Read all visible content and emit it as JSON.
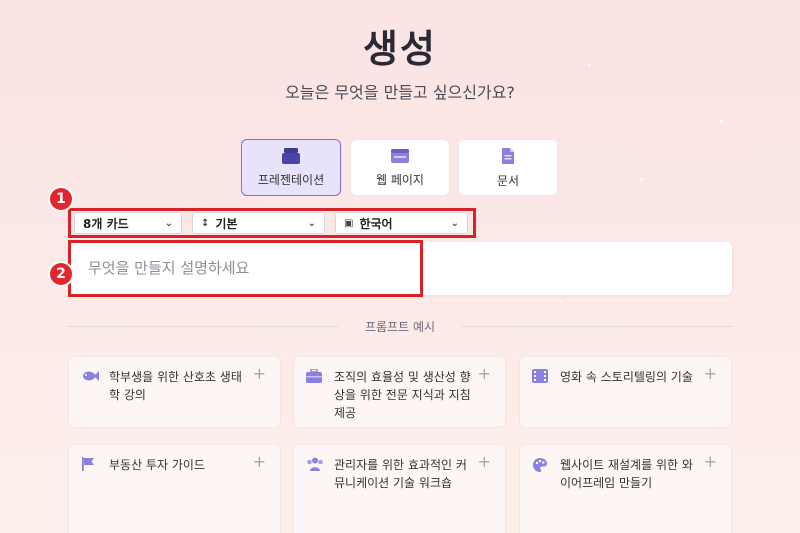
{
  "header": {
    "title": "생성",
    "subtitle": "오늘은 무엇을 만들고 싶으신가요?"
  },
  "content_types": [
    {
      "label": "프레젠테이션",
      "icon": "presentation-icon",
      "active": true
    },
    {
      "label": "웹 페이지",
      "icon": "web-page-icon",
      "active": false
    },
    {
      "label": "문서",
      "icon": "document-icon",
      "active": false
    }
  ],
  "annotations": {
    "badge_1": "1",
    "badge_2": "2"
  },
  "options": {
    "cards": "8개 카드",
    "style": "기본",
    "language": "한국어"
  },
  "prompt": {
    "placeholder": "무엇을 만들지 설명하세요",
    "value": ""
  },
  "examples": {
    "label": "프롬프트 예시",
    "items": [
      {
        "text": "학부생을 위한 산호초 생태학 강의",
        "icon": "fish-icon"
      },
      {
        "text": "조직의 효율성 및 생산성 향상을 위한 전문 지식과 지침 제공",
        "icon": "briefcase-icon"
      },
      {
        "text": "영화 속 스토리텔링의 기술",
        "icon": "film-icon"
      },
      {
        "text": "부동산 투자 가이드",
        "icon": "flag-icon"
      },
      {
        "text": "관리자를 위한 효과적인 커뮤니케이션 기술 워크숍",
        "icon": "people-icon"
      },
      {
        "text": "웹사이트 재설계를 위한 와이어프레임 만들기",
        "icon": "palette-icon"
      }
    ],
    "plus": "+"
  },
  "colors": {
    "accent": "#7b6fd9",
    "annotation_red": "#d6232a",
    "icon_purple": "#8b7fe0"
  }
}
